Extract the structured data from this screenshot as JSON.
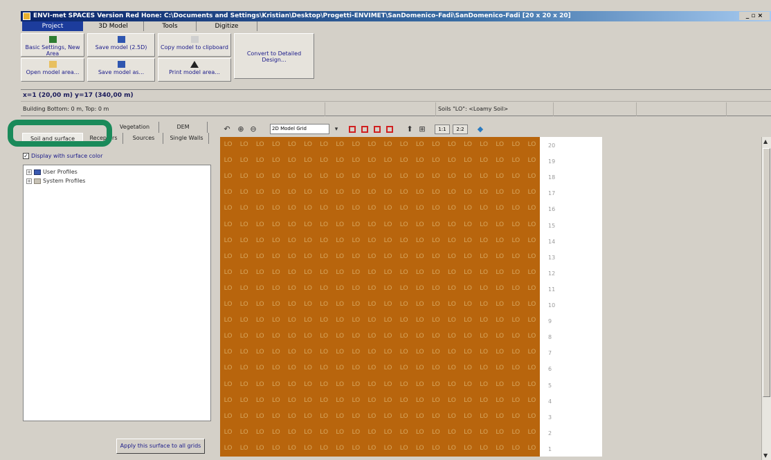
{
  "window": {
    "title": "ENVI-met SPACES Version Red Hone: C:\\Documents and Settings\\Kristian\\Desktop\\Progetti-ENVIMET\\SanDomenico-Fadi\\SanDomenico-Fadi [20 x 20 x 20]",
    "controls": "_ ▫ ×"
  },
  "ribbon_tabs": [
    "Project",
    "3D Model",
    "Tools",
    "Digitize"
  ],
  "ribbon": {
    "basic_settings": "Basic Settings, New Area",
    "open_model": "Open model area...",
    "save_model": "Save model (2.5D)",
    "save_model_as": "Save model as...",
    "copy_model": "Copy model to clipboard",
    "print_model": "Print model area...",
    "convert": "Convert to Detailed Design..."
  },
  "status": {
    "coords": "x=1 (20,00 m) y=17 (340,00 m)",
    "building": "Building Bottom: 0 m, Top: 0 m",
    "soils": "Soils \"LO\": <Loamy Soil>"
  },
  "left_tabs": {
    "row1": [
      "Vegetation",
      "DEM"
    ],
    "row2": [
      "Soil and surface",
      "Receptors",
      "Sources",
      "Single Walls"
    ]
  },
  "display_surface_color": "Display with surface color",
  "tree": [
    "User Profiles",
    "System Profiles"
  ],
  "apply_button": "Apply this surface to all grids",
  "map_toolbar": {
    "layer": "2D Model Grid",
    "scale1": "1:1",
    "scale2": "2:2"
  },
  "grid": {
    "cell_label": "LO",
    "rows": 20,
    "cols": 20,
    "color": "#b8650d"
  },
  "row_labels": [
    "20",
    "19",
    "18",
    "17",
    "16",
    "15",
    "14",
    "13",
    "12",
    "11",
    "10",
    "9",
    "8",
    "7",
    "6",
    "5",
    "4",
    "3",
    "2",
    "1"
  ]
}
